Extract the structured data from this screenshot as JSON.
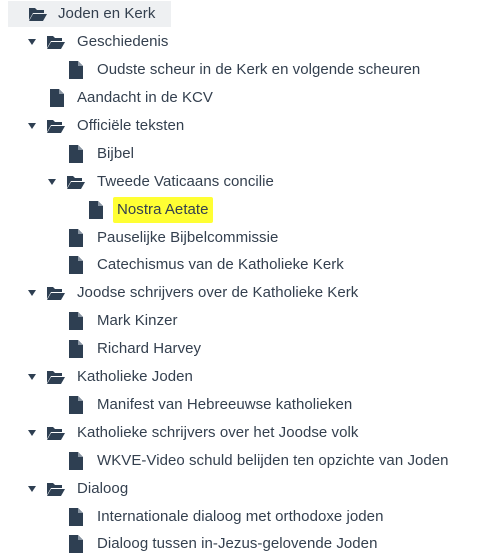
{
  "tree": {
    "root": {
      "label": "Joden en Kerk",
      "icon": "folder-open-icon"
    },
    "items": [
      {
        "label": "Geschiedenis",
        "icon": "folder-open-icon",
        "expanded": true
      },
      {
        "label": "Oudste scheur in de Kerk en volgende scheuren",
        "icon": "document-icon"
      },
      {
        "label": "Aandacht in de KCV",
        "icon": "document-icon"
      },
      {
        "label": "Officiële teksten",
        "icon": "folder-open-icon",
        "expanded": true
      },
      {
        "label": "Bijbel",
        "icon": "document-icon"
      },
      {
        "label": "Tweede Vaticaans concilie",
        "icon": "folder-open-icon",
        "expanded": true
      },
      {
        "label": "Nostra Aetate",
        "icon": "document-icon",
        "highlight_color": "#ffff33"
      },
      {
        "label": "Pauselijke Bijbelcommissie",
        "icon": "document-icon"
      },
      {
        "label": "Catechismus van de Katholieke Kerk",
        "icon": "document-icon"
      },
      {
        "label": "Joodse schrijvers over de Katholieke Kerk",
        "icon": "folder-open-icon",
        "expanded": true
      },
      {
        "label": "Mark Kinzer",
        "icon": "document-icon"
      },
      {
        "label": "Richard Harvey",
        "icon": "document-icon"
      },
      {
        "label": "Katholieke Joden",
        "icon": "folder-open-icon",
        "expanded": true
      },
      {
        "label": "Manifest van Hebreeuwse katholieken",
        "icon": "document-icon"
      },
      {
        "label": "Katholieke schrijvers over het Joodse volk",
        "icon": "folder-open-icon",
        "expanded": true
      },
      {
        "label": "WKVE-Video schuld belijden ten opzichte van Joden",
        "icon": "document-icon"
      },
      {
        "label": "Dialoog",
        "icon": "folder-open-icon",
        "expanded": true
      },
      {
        "label": "Internationale dialoog met orthodoxe joden",
        "icon": "document-icon"
      },
      {
        "label": "Dialoog tussen in-Jezus-gelovende Joden",
        "icon": "document-icon"
      }
    ]
  },
  "colors": {
    "icon": "#2e3f52",
    "text": "#34404f",
    "root_background": "#eef0f2",
    "highlight": "#ffff33"
  }
}
